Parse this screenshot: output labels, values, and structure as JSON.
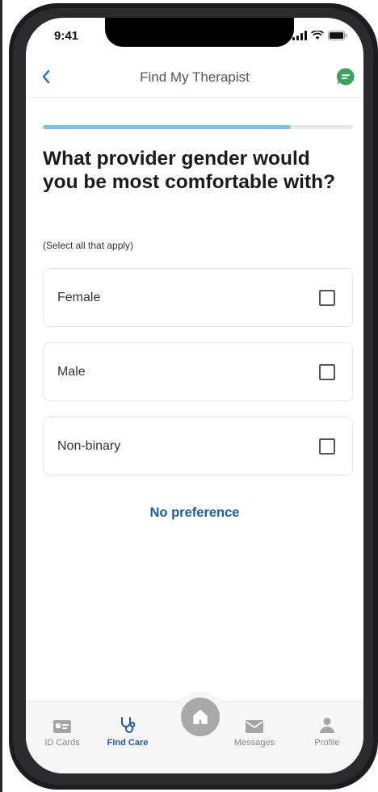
{
  "status_bar": {
    "time": "9:41"
  },
  "nav": {
    "back_label": "<",
    "title": "Find My Therapist"
  },
  "progress": {
    "value": 0.8
  },
  "question": {
    "title": "What provider gender would you be most comfortable with?",
    "hint": "(Select all that apply)"
  },
  "options": [
    {
      "label": "Female",
      "checked": false
    },
    {
      "label": "Male",
      "checked": false
    },
    {
      "label": "Non-binary",
      "checked": false
    }
  ],
  "no_preference_label": "No preference",
  "tabs": [
    {
      "label": "ID Cards",
      "icon": "id-card-icon",
      "active": false
    },
    {
      "label": "Find Care",
      "icon": "stethoscope-icon",
      "active": true
    },
    {
      "label": "Home",
      "icon": "home-icon",
      "active": false
    },
    {
      "label": "Messages",
      "icon": "envelope-icon",
      "active": false
    },
    {
      "label": "Profile",
      "icon": "person-icon",
      "active": false
    }
  ],
  "colors": {
    "accent": "#1c5fa0",
    "progress": "#7fc0ee",
    "chat_badge": "#3aa35b"
  }
}
